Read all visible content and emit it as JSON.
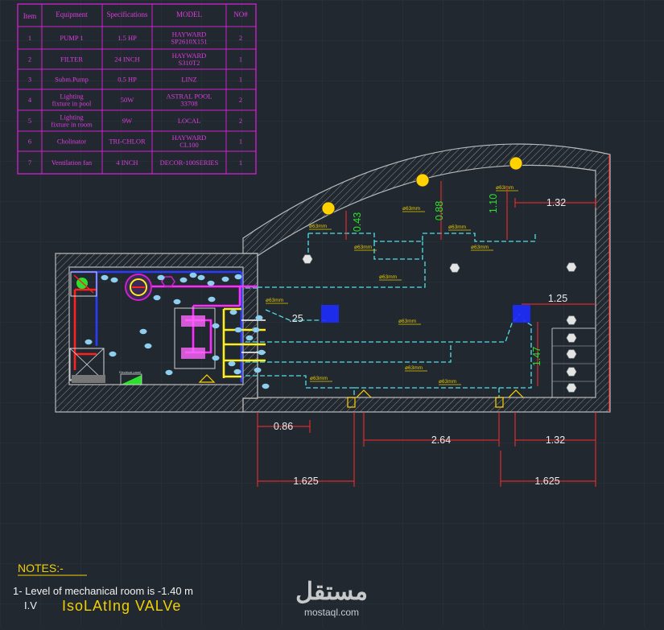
{
  "colors": {
    "background": "#212830",
    "grid": "#2c343d",
    "table_border": "#d21fd2",
    "table_text": "#e03ce0",
    "wall": "#b9b9b9",
    "pipe_cyan": "#4fe0e8",
    "pipe_magenta": "#ff2cff",
    "pipe_red": "#ff2020",
    "pipe_blue": "#2a3cff",
    "pipe_yellow": "#ffee22",
    "dim_red": "#ff2b2b",
    "dim_text": "#e9e9e9",
    "dim_green": "#2de02d",
    "label_yellow": "#e6c800",
    "notes_yellow": "#f2d000",
    "notes_white": "#f2f2f2",
    "watermark": "#e6e6e6"
  },
  "equipment_table": {
    "headers": [
      "Item",
      "Equipment",
      "Specifications",
      "MODEL",
      "NO#"
    ],
    "rows": [
      {
        "item": "1",
        "equipment": [
          "PUMP 1"
        ],
        "spec": "1.5 HP",
        "model": [
          "HAYWARD",
          "SP2610X151"
        ],
        "qty": "2"
      },
      {
        "item": "2",
        "equipment": [
          "FILTER"
        ],
        "spec": "24 INCH",
        "model": [
          "HAYWARD",
          "S310T2"
        ],
        "qty": "1"
      },
      {
        "item": "3",
        "equipment": [
          "Subm.Pump"
        ],
        "spec": "0.5 HP",
        "model": [
          "LINZ"
        ],
        "qty": "1"
      },
      {
        "item": "4",
        "equipment": [
          "Lighting",
          "fixture in pool"
        ],
        "spec": "50W",
        "model": [
          "ASTRAL POOL",
          "33708"
        ],
        "qty": "2"
      },
      {
        "item": "5",
        "equipment": [
          "Lighting",
          "fixture in room"
        ],
        "spec": "9W",
        "model": [
          "LOCAL"
        ],
        "qty": "2"
      },
      {
        "item": "6",
        "equipment": [
          "Cholinator"
        ],
        "spec": "TRI-CHLOR",
        "model": [
          "HAYWARD",
          "CL100"
        ],
        "qty": "1"
      },
      {
        "item": "7",
        "equipment": [
          "Ventilation fan"
        ],
        "spec": "4 INCH",
        "model": [
          "DECOR-100SERIES"
        ],
        "qty": "1"
      }
    ]
  },
  "dimensions": {
    "h_top_right": "1.32",
    "h_right_mid": "1.25",
    "h_left_short": ".25",
    "v_left": "0.43",
    "v_center": "0.88",
    "v_right": "1.10",
    "v_right_side": "1.47",
    "bottom_a": "0.86",
    "bottom_b": "2.64",
    "bottom_c": "1.32",
    "bottom_d": "1.625",
    "bottom_e": "1.625"
  },
  "pipe_label": "ø63mm",
  "panel_label": "Electrical panel",
  "notes": {
    "title": "NOTES:-",
    "line1": "1- Level of mechanical room is -1.40 m",
    "iv_abbr": "I.V",
    "iv_text": "IsoLAtIng VALVe"
  },
  "watermark": {
    "arabic": "مستقل",
    "latin": "mostaql.com"
  }
}
